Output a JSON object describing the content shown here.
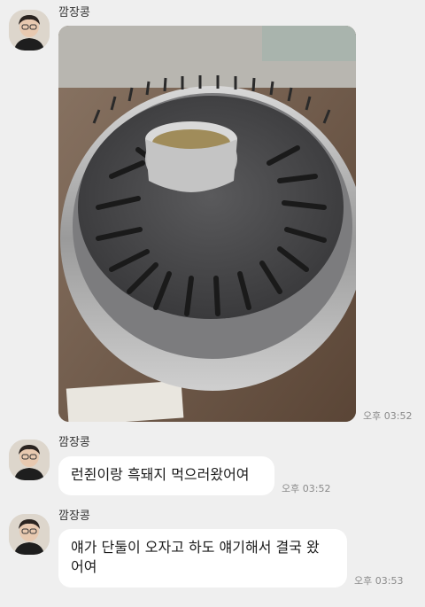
{
  "messages": [
    {
      "sender": "깜장콩",
      "type": "photo",
      "photo_desc": "grill-pan",
      "time": "오후 03:52"
    },
    {
      "sender": "깜장콩",
      "type": "text",
      "text": "런쥔이랑 흑돼지 먹으러왔어여",
      "time": "오후 03:52"
    },
    {
      "sender": "깜장콩",
      "type": "text",
      "text_line1": "얘가 단둘이 오자고 하도 얘기해서 결국 왔",
      "text_line2": "어여",
      "time": "오후 03:53"
    }
  ],
  "colors": {
    "background": "#efefef",
    "bubble": "#ffffff",
    "time_text": "#8a8a8a"
  }
}
